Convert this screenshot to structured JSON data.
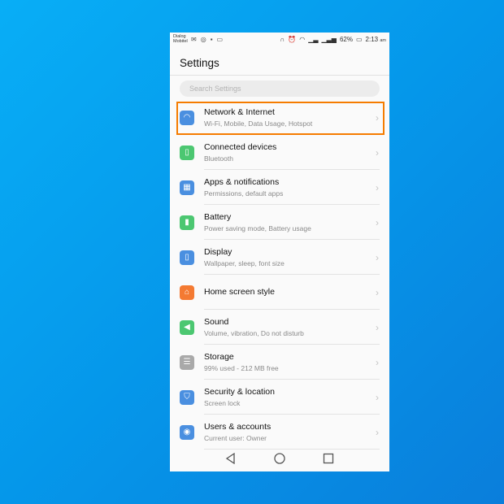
{
  "status_bar": {
    "carrier": [
      "Dialog",
      "Mobitel"
    ],
    "battery": "62%",
    "time": "2:13",
    "ampm": "am"
  },
  "header": {
    "title": "Settings"
  },
  "search": {
    "placeholder": "Search Settings"
  },
  "items": [
    {
      "title": "Network & Internet",
      "subtitle": "Wi-Fi, Mobile, Data Usage, Hotspot",
      "icon": "wifi-icon",
      "color": "#4a8fe0",
      "glyph": "◠"
    },
    {
      "title": "Connected devices",
      "subtitle": "Bluetooth",
      "icon": "devices-icon",
      "color": "#4cc771",
      "glyph": "▯"
    },
    {
      "title": "Apps & notifications",
      "subtitle": "Permissions, default apps",
      "icon": "apps-icon",
      "color": "#4a8fe0",
      "glyph": "▦"
    },
    {
      "title": "Battery",
      "subtitle": "Power saving mode, Battery usage",
      "icon": "battery-icon",
      "color": "#4cc771",
      "glyph": "▮"
    },
    {
      "title": "Display",
      "subtitle": "Wallpaper, sleep, font size",
      "icon": "display-icon",
      "color": "#4a8fe0",
      "glyph": "▯"
    },
    {
      "title": "Home screen style",
      "subtitle": "",
      "icon": "home-icon",
      "color": "#f47a32",
      "glyph": "⌂"
    },
    {
      "title": "Sound",
      "subtitle": "Volume, vibration, Do not disturb",
      "icon": "sound-icon",
      "color": "#4cc771",
      "glyph": "◀"
    },
    {
      "title": "Storage",
      "subtitle": "99% used - 212 MB free",
      "icon": "storage-icon",
      "color": "#a9a9a9",
      "glyph": "☰"
    },
    {
      "title": "Security & location",
      "subtitle": "Screen lock",
      "icon": "shield-icon",
      "color": "#4a8fe0",
      "glyph": "⛉"
    },
    {
      "title": "Users & accounts",
      "subtitle": "Current user: Owner",
      "icon": "user-icon",
      "color": "#4a8fe0",
      "glyph": "◉"
    }
  ],
  "highlight_color": "#f57c00"
}
